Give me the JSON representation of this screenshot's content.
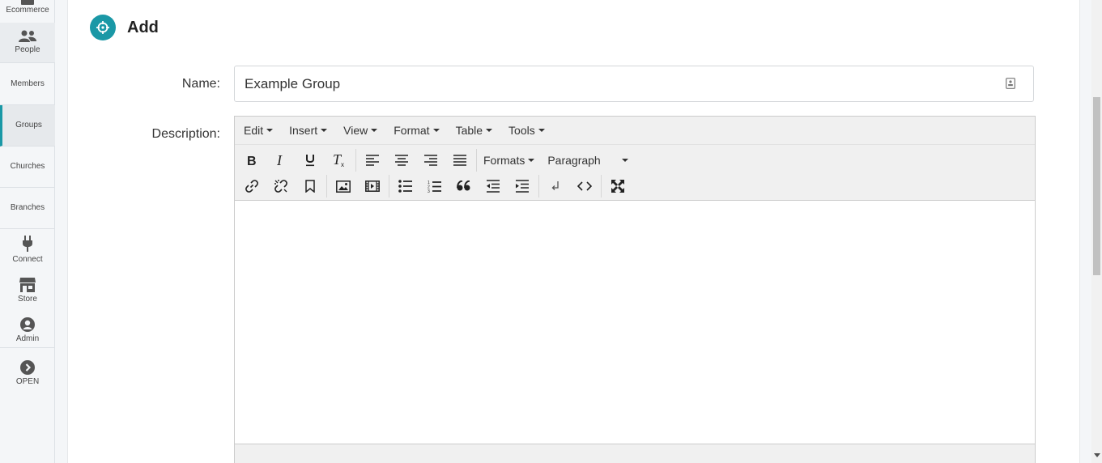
{
  "sidebar": {
    "items": [
      {
        "label": "Ecommerce",
        "icon": "shopping-basket-icon"
      },
      {
        "label": "People",
        "icon": "users-icon"
      },
      {
        "label": "Members"
      },
      {
        "label": "Groups"
      },
      {
        "label": "Churches"
      },
      {
        "label": "Branches"
      },
      {
        "label": "Connect",
        "icon": "plug-icon"
      },
      {
        "label": "Store",
        "icon": "store-icon"
      },
      {
        "label": "Admin",
        "icon": "user-circle-icon"
      },
      {
        "label": "OPEN",
        "icon": "chevron-right-circle-icon"
      }
    ],
    "active": "Groups",
    "accent_color": "#1a98a6"
  },
  "page": {
    "title": "Add",
    "title_icon": "crosshair-icon"
  },
  "form": {
    "name_label": "Name:",
    "name_value": "Example Group",
    "name_field_icon": "contact-card-icon",
    "description_label": "Description:"
  },
  "editor": {
    "menus": [
      "Edit",
      "Insert",
      "View",
      "Format",
      "Table",
      "Tools"
    ],
    "formats_label": "Formats",
    "paragraph_label": "Paragraph",
    "toolbar_row1_icons": [
      "bold-icon",
      "italic-icon",
      "underline-icon",
      "clear-formatting-icon",
      "align-left-icon",
      "align-center-icon",
      "align-right-icon",
      "align-justify-icon"
    ],
    "toolbar_row2_icons": [
      "link-icon",
      "unlink-icon",
      "bookmark-icon",
      "image-icon",
      "media-icon",
      "bullet-list-icon",
      "numbered-list-icon",
      "blockquote-icon",
      "outdent-icon",
      "indent-icon",
      "nonbreaking-icon",
      "code-icon",
      "fullscreen-icon"
    ]
  }
}
